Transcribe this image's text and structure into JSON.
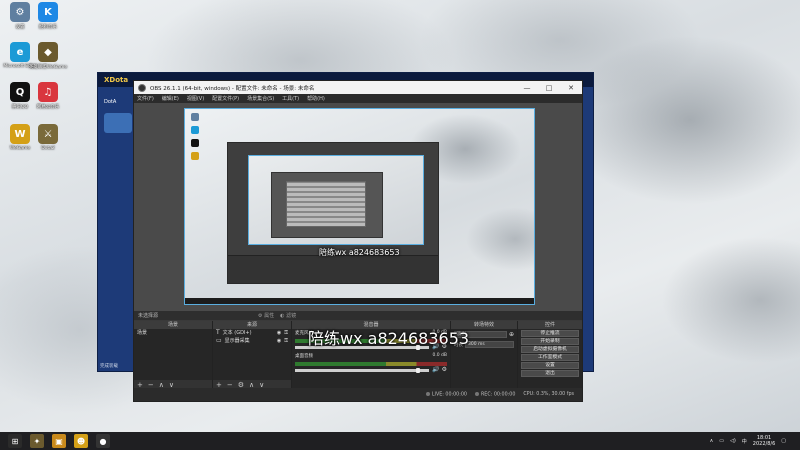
{
  "desktop": {
    "icons": [
      {
        "label": "设置",
        "color": "#5f7fa0",
        "glyph": "⚙",
        "icon": "settings-icon"
      },
      {
        "label": "酷狗音乐",
        "color": "#1e88e5",
        "glyph": "K",
        "icon": "kugou-icon"
      },
      {
        "label": "Microsoft Edge",
        "color": "#1c9ad6",
        "glyph": "e",
        "icon": "edge-icon"
      },
      {
        "label": "英雄联盟WeGame",
        "color": "#6b5a2e",
        "glyph": "◆",
        "icon": "wegame-icon"
      },
      {
        "label": "腾讯QQ",
        "color": "#111111",
        "glyph": "Q",
        "icon": "qq-icon"
      },
      {
        "label": "网易云音乐",
        "color": "#d9363e",
        "glyph": "♫",
        "icon": "netease-music-icon"
      },
      {
        "label": "WeGame",
        "color": "#d4a017",
        "glyph": "W",
        "icon": "wegame2-icon"
      },
      {
        "label": "Dota2",
        "color": "#7a6a3a",
        "glyph": "⚔",
        "icon": "dota-icon"
      }
    ]
  },
  "bg_window": {
    "title": "XDota",
    "nav": "DotA",
    "status": "完成装载"
  },
  "obs": {
    "title": "OBS 26.1.1 (64-bit, windows) - 配置文件: 未命名 - 场景: 未命名",
    "win_buttons": [
      "—",
      "□",
      "✕"
    ],
    "menu": [
      "文件(F)",
      "编辑(E)",
      "视图(V)",
      "配置文件(P)",
      "场景集合(S)",
      "工具(T)",
      "帮助(H)"
    ],
    "source_toolbar": {
      "label": "未选择源",
      "props": "属性",
      "filters": "滤镜"
    },
    "docks": {
      "scenes": {
        "title": "场景",
        "items": [
          "场景"
        ]
      },
      "sources": {
        "title": "来源",
        "items": [
          {
            "label": "文本 (GDI+)",
            "glyph": "T"
          },
          {
            "label": "显示器采集",
            "glyph": "▭"
          }
        ]
      },
      "mixer": {
        "title": "混音器",
        "channels": [
          {
            "name": "麦克风/Aux",
            "db": "0.0 dB",
            "level": 0.92
          },
          {
            "name": "桌面音频",
            "db": "0.0 dB",
            "level": 0.92
          }
        ]
      },
      "transitions": {
        "title": "转场特效",
        "type": "淡出",
        "duration_label": "时长",
        "duration": "300 ms"
      },
      "controls": {
        "title": "控件",
        "buttons": [
          "停止推流",
          "开始录制",
          "启动虚拟摄像机",
          "工作室模式",
          "设置",
          "退出"
        ]
      }
    },
    "status": {
      "live": "LIVE: 00:00:00",
      "rec": "REC: 00:00:00",
      "cpu": "CPU: 0.3%, 30.00 fps"
    }
  },
  "watermarks": {
    "main": "陪练wx a824683653",
    "preview": "陪练wx a824683653"
  },
  "taskbar": {
    "icons": [
      {
        "glyph": "⊞",
        "icon": "start-icon",
        "color": "#2a2a2a"
      },
      {
        "glyph": "✦",
        "icon": "game-icon",
        "color": "#6b5a2e"
      },
      {
        "glyph": "▣",
        "icon": "app-icon",
        "color": "#c98a1c"
      },
      {
        "glyph": "☻",
        "icon": "wegame-taskbar-icon",
        "color": "#d4a017"
      },
      {
        "glyph": "●",
        "icon": "obs-taskbar-icon",
        "color": "#333333"
      }
    ],
    "ime": "中",
    "time": "18:01",
    "date": "2022/8/6"
  }
}
